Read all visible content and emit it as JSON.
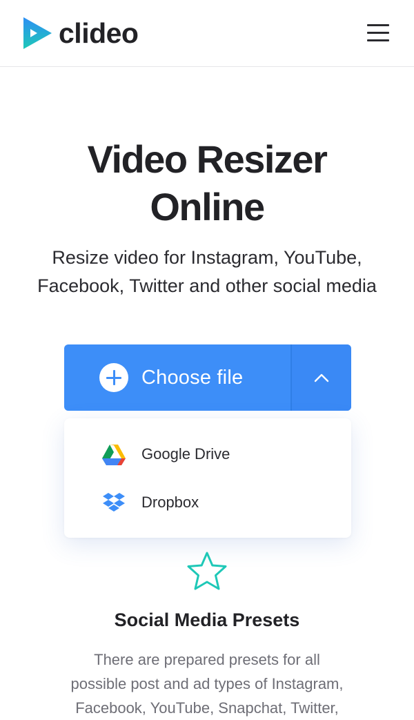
{
  "header": {
    "logo_text": "clideo",
    "menu_icon": "hamburger-menu-icon"
  },
  "hero": {
    "title_line1": "Video Resizer",
    "title_line2": "Online",
    "subtitle_line1": "Resize video for Instagram, YouTube,",
    "subtitle_line2": "Facebook, Twitter and other social media"
  },
  "upload": {
    "choose_label": "Choose file",
    "plus_icon": "plus-circle-icon",
    "toggle_icon": "chevron-up-icon",
    "accent_color": "#3d8ef8",
    "options": [
      {
        "label": "Google Drive",
        "icon": "google-drive-icon"
      },
      {
        "label": "Dropbox",
        "icon": "dropbox-icon"
      }
    ]
  },
  "feature": {
    "icon": "star-icon",
    "icon_color": "#1ec8b7",
    "title": "Social Media Presets",
    "text_line1": "There are prepared presets for all",
    "text_line2": "possible post and ad types of Instagram,",
    "text_line3": "Facebook, YouTube, Snapchat, Twitter,"
  }
}
